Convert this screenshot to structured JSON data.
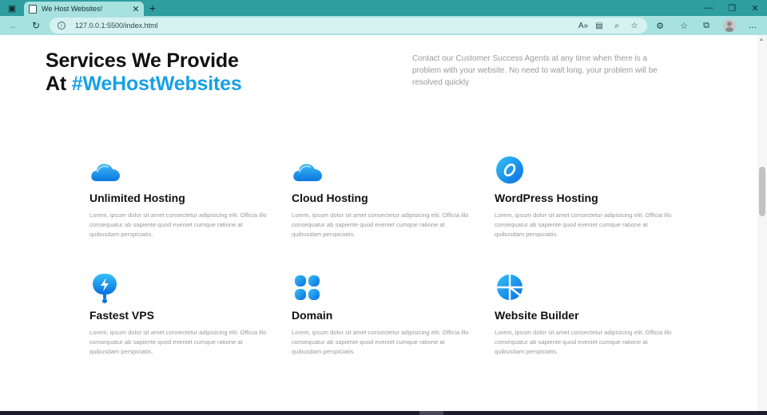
{
  "browser": {
    "tab_title": "We Host Websites!",
    "url": "127.0.0.1:5500/index.html"
  },
  "hero": {
    "title_line1": "Services We Provide",
    "title_line2_prefix": "At ",
    "title_highlight": "#WeHostWebsites",
    "description": "Contact our Customer Success Agents at any time when there is a problem with your website. No need to wait long, your problem will be resolved quickly"
  },
  "services": [
    {
      "title": "Unlimited Hosting",
      "icon": "cloud-icon",
      "description": "Lorem, ipsum dolor sit amet consectetur adipisicing elit. Officia illo consequatur ab sapiente quod eveniet cumque ratione at quibusdam perspiciatis."
    },
    {
      "title": "Cloud Hosting",
      "icon": "cloud-icon",
      "description": "Lorem, ipsum dolor sit amet consectetur adipisicing elit. Officia illo consequatur ab sapiente quod eveniet cumque ratione at quibusdam perspiciatis."
    },
    {
      "title": "WordPress Hosting",
      "icon": "ring-icon",
      "description": "Lorem, ipsum dolor sit amet consectetur adipisicing elit. Officia illo consequatur ab sapiente quod eveniet cumque ratione at quibusdam perspiciatis."
    },
    {
      "title": "Fastest VPS",
      "icon": "lightning-pin-icon",
      "description": "Lorem, ipsum dolor sit amet consectetur adipisicing elit. Officia illo consequatur ab sapiente quod eveniet cumque ratione at quibusdam perspiciatis."
    },
    {
      "title": "Domain",
      "icon": "grid-icon",
      "description": "Lorem, ipsum dolor sit amet consectetur adipisicing elit. Officia illo consequatur ab sapiente quod eveniet cumque ratione at quibusdam perspiciatis."
    },
    {
      "title": "Website Builder",
      "icon": "pie-icon",
      "description": "Lorem, ipsum dolor sit amet consectetur adipisicing elit. Officia illo consequatur ab sapiente quod eveniet cumque ratione at quibusdam perspiciatis."
    }
  ],
  "colors": {
    "accent": "#17a0e6",
    "chrome_tabbar": "#2e9ea0",
    "chrome_toolbar": "#a8e2e0",
    "muted_text": "#9a9a9a"
  }
}
